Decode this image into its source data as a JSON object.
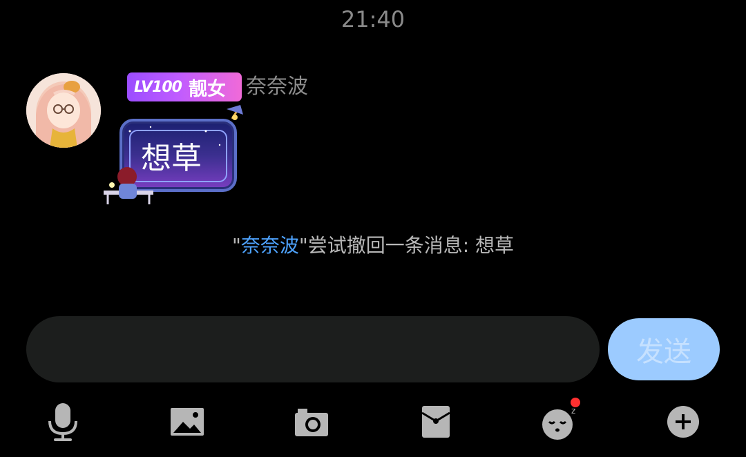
{
  "timestamp": "21:40",
  "message": {
    "badge": {
      "level": "LV100",
      "title": "靓女"
    },
    "sender": "奈奈波",
    "text": "想草"
  },
  "system_notice": {
    "quote_open": "\"",
    "name": "奈奈波",
    "rest": "\"尝试撤回一条消息: 想草"
  },
  "composer": {
    "input_value": "",
    "send_label": "发送"
  },
  "toolbar": {
    "icons": [
      "microphone-icon",
      "image-icon",
      "camera-icon",
      "red-packet-icon",
      "sticker-face-icon",
      "plus-icon"
    ],
    "sticker_has_notification": true
  },
  "colors": {
    "background": "#000000",
    "accent_link": "#4ea3ff",
    "send_button": "#9ccbff",
    "input_bg": "#1c1e1d",
    "badge_start": "#9b4dff",
    "badge_end": "#f06ad8",
    "notification_dot": "#ff3030"
  }
}
